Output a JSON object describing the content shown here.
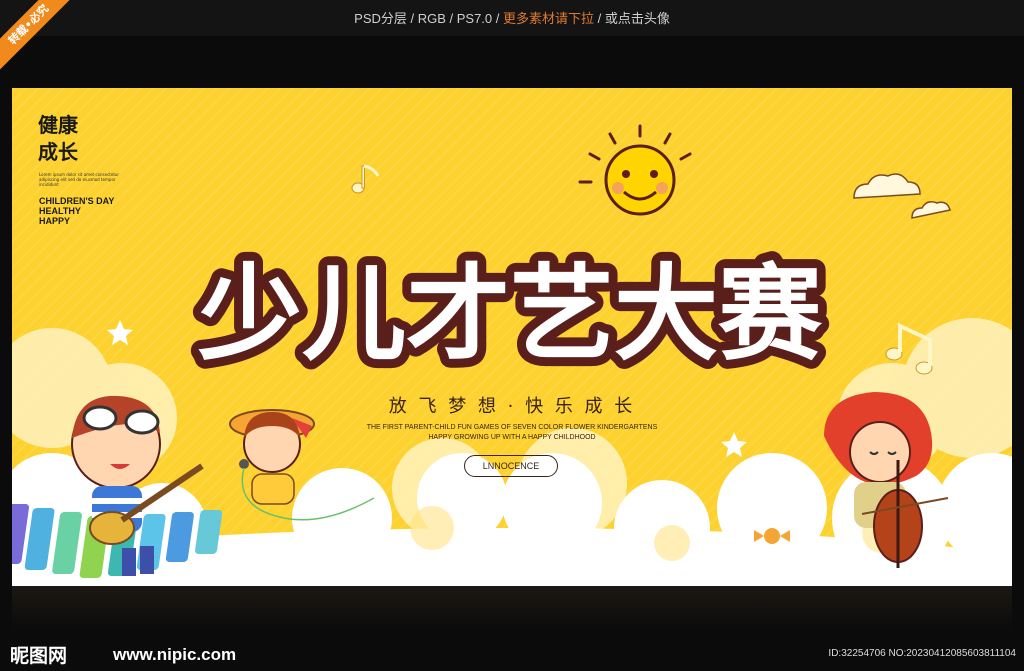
{
  "watermark": {
    "ribbon": "转载•必究",
    "info_prefix": "PSD分层 / RGB / PS7.0 / ",
    "info_highlight": "更多素材请下拉",
    "info_suffix": " / 或点击头像"
  },
  "poster": {
    "vertical_text": [
      "健康",
      "成长"
    ],
    "tiny_text": "Lorem ipsum dolor sit amet consectetur adipiscing elit sed do eiusmod tempor incididunt",
    "english_lines": [
      "CHILDREN'S DAY",
      "HEALTHY",
      "HAPPY"
    ],
    "title": "少儿才艺大赛",
    "slogan": "放 飞 梦 想 · 快 乐 成 长",
    "subtitle_line1": "THE FIRST PARENT-CHILD FUN GAMES OF SEVEN COLOR FLOWER KINDERGARTENS",
    "subtitle_line2": "HAPPY GROWING UP WITH A HAPPY CHILDHOOD",
    "badge": "LNNOCENCE"
  },
  "footer": {
    "logo": "昵图网",
    "url": "www.nipic.com",
    "id_text": "ID:32254706 NO:20230412085603811104"
  },
  "colors": {
    "background": "#fdd12e",
    "title_fill": "#ffffff",
    "title_outline": "#5a1f1a",
    "title_pink": "#f6a8a0",
    "cloud": "#ffffff",
    "accent_orange": "#f08a1c"
  }
}
